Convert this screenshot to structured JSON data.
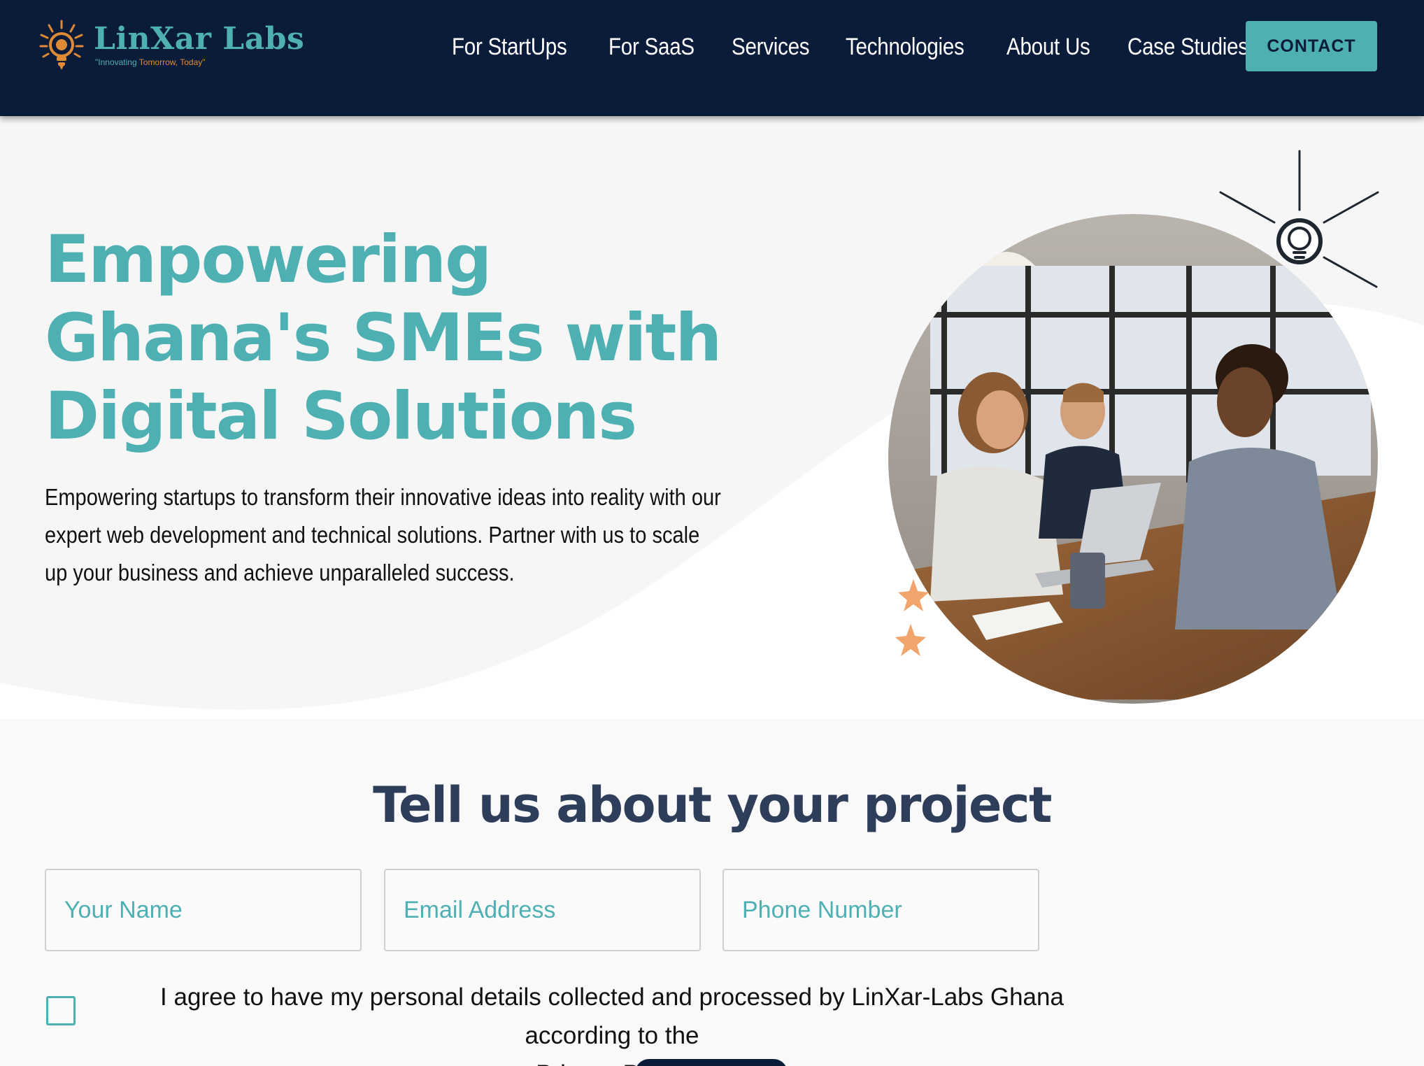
{
  "header": {
    "logo": {
      "name": "LinXar Labs",
      "tagline_part1": "\"Innovating ",
      "tagline_part2": "Tomorrow, Today\""
    },
    "nav": [
      {
        "label": "For StartUps"
      },
      {
        "label": "For SaaS"
      },
      {
        "label": "Services"
      },
      {
        "label": "Technologies"
      },
      {
        "label": "About Us"
      },
      {
        "label": "Case Studies"
      }
    ],
    "contact_label": "CONTACT"
  },
  "hero": {
    "title": "Empowering Ghana's SMEs with Digital Solutions",
    "description": "Empowering startups to transform their innovative ideas into reality with our expert web development and technical solutions. Partner with us to scale up your business and achieve unparalleled success."
  },
  "form": {
    "title": "Tell us about your project",
    "name_placeholder": "Your Name",
    "email_placeholder": "Email Address",
    "phone_placeholder": "Phone Number",
    "consent_text": "I agree to have my personal details collected and processed by LinXar-Labs Ghana according to the",
    "consent_link": "Privacy Policy"
  },
  "colors": {
    "navy": "#0b1c3b",
    "teal": "#4fb0b3",
    "orange": "#e08a35",
    "heading_dark": "#2e3d59"
  },
  "icons": [
    "lightbulb-logo-icon",
    "lightbulb-icon",
    "star-icon"
  ]
}
